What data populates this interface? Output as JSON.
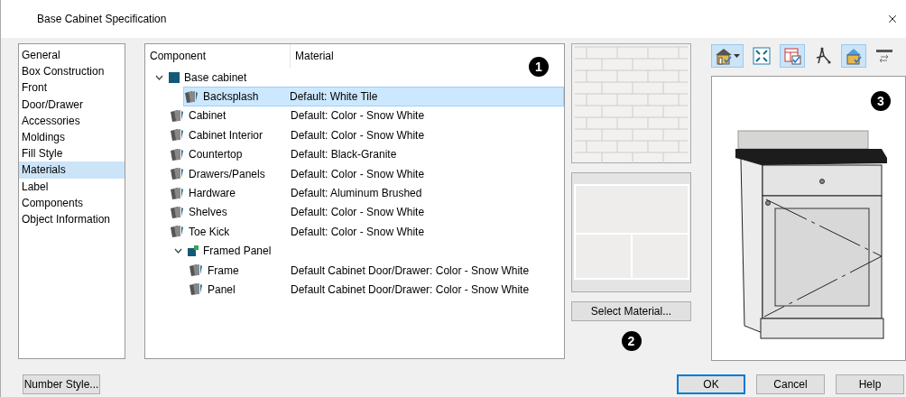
{
  "window": {
    "title": "Base Cabinet Specification"
  },
  "sidebar": {
    "items": [
      {
        "label": "General",
        "selected": false
      },
      {
        "label": "Box Construction",
        "selected": false
      },
      {
        "label": "Front",
        "selected": false
      },
      {
        "label": "Door/Drawer",
        "selected": false
      },
      {
        "label": "Accessories",
        "selected": false
      },
      {
        "label": "Moldings",
        "selected": false
      },
      {
        "label": "Fill Style",
        "selected": false
      },
      {
        "label": "Materials",
        "selected": true
      },
      {
        "label": "Label",
        "selected": false
      },
      {
        "label": "Components",
        "selected": false
      },
      {
        "label": "Object Information",
        "selected": false
      }
    ]
  },
  "tree": {
    "columns": [
      "Component",
      "Material"
    ],
    "callout": "1",
    "nodes": [
      {
        "kind": "group",
        "name": "Base cabinet",
        "expanded": true,
        "selected": false,
        "children": [
          {
            "kind": "material",
            "name": "Backsplash",
            "material": "Default: White Tile",
            "selected": true
          },
          {
            "kind": "material",
            "name": "Cabinet",
            "material": "Default: Color - Snow White",
            "selected": false
          },
          {
            "kind": "material",
            "name": "Cabinet Interior",
            "material": "Default: Color - Snow White",
            "selected": false
          },
          {
            "kind": "material",
            "name": "Countertop",
            "material": "Default: Black-Granite",
            "selected": false
          },
          {
            "kind": "material",
            "name": "Drawers/Panels",
            "material": "Default: Color - Snow White",
            "selected": false
          },
          {
            "kind": "material",
            "name": "Hardware",
            "material": "Default: Aluminum Brushed",
            "selected": false
          },
          {
            "kind": "material",
            "name": "Shelves",
            "material": "Default: Color - Snow White",
            "selected": false
          },
          {
            "kind": "material",
            "name": "Toe Kick",
            "material": "Default: Color - Snow White",
            "selected": false
          },
          {
            "kind": "panel",
            "name": "Framed Panel",
            "expanded": true,
            "selected": false,
            "children": [
              {
                "kind": "material",
                "name": "Frame",
                "material": "Default Cabinet Door/Drawer: Color - Snow White",
                "selected": false
              },
              {
                "kind": "material",
                "name": "Panel",
                "material": "Default Cabinet Door/Drawer: Color - Snow White",
                "selected": false
              }
            ]
          }
        ]
      }
    ]
  },
  "material_preview": {
    "button": "Select Material...",
    "callout": "2"
  },
  "view": {
    "callout": "3",
    "tools": [
      {
        "kind": "house",
        "on": true,
        "dropdown": true
      },
      {
        "kind": "fit",
        "on": false,
        "dropdown": false
      },
      {
        "kind": "layers",
        "on": true,
        "dropdown": false
      },
      {
        "kind": "tree",
        "on": false,
        "dropdown": false
      },
      {
        "kind": "color",
        "on": true,
        "dropdown": false
      },
      {
        "kind": "rotate",
        "on": false,
        "dropdown": false
      }
    ]
  },
  "buttons": {
    "left": "Number Style...",
    "ok": "OK",
    "cancel": "Cancel",
    "help": "Help"
  }
}
